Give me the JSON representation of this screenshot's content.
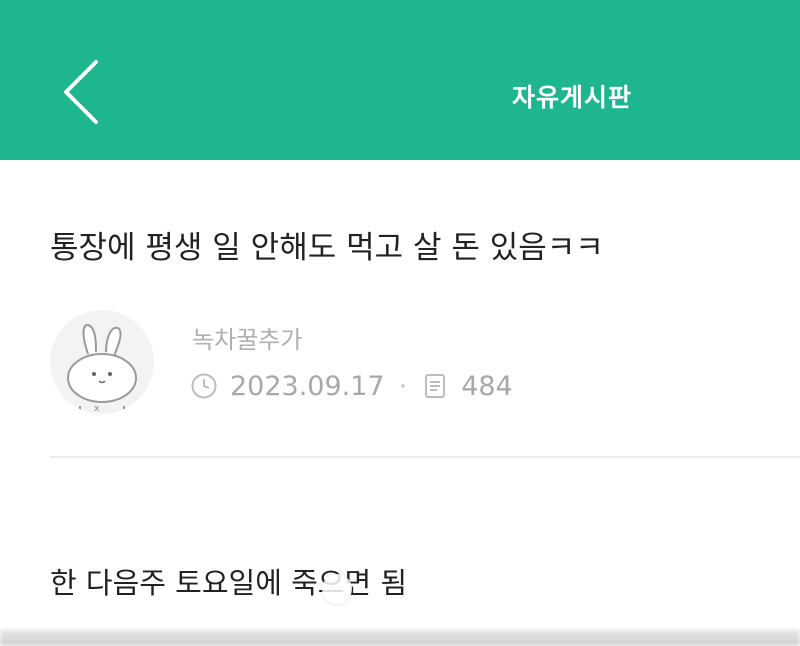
{
  "header": {
    "back_icon": "chevron-left-icon",
    "title": "자유게시판",
    "color": "#1eb591"
  },
  "post": {
    "title": "통장에 평생 일 안해도 먹고 살 돈 있음ㅋㅋ",
    "author": "녹차꿀추가",
    "date_icon": "clock-icon",
    "date": "2023.09.17",
    "separator": "·",
    "views_icon": "document-icon",
    "views": "484",
    "body": "한 다음주 토요일에 죽으면 됨"
  }
}
